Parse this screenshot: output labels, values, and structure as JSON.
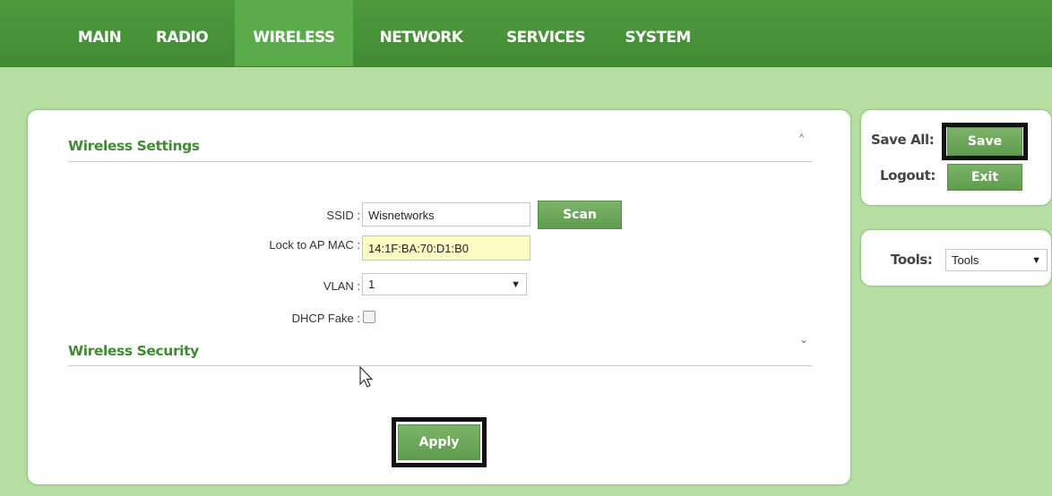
{
  "nav": {
    "tabs": [
      {
        "label": "MAIN"
      },
      {
        "label": "RADIO"
      },
      {
        "label": "WIRELESS",
        "active": true
      },
      {
        "label": "NETWORK"
      },
      {
        "label": "SERVICES"
      },
      {
        "label": "SYSTEM"
      }
    ]
  },
  "wireless_settings": {
    "title": "Wireless Settings",
    "collapse_icon": "chevron-up-icon",
    "ssid": {
      "label": "SSID :",
      "value": "Wisnetworks"
    },
    "scan_label": "Scan",
    "lock_ap_mac": {
      "label": "Lock to AP MAC :",
      "value": "14:1F:BA:70:D1:B0"
    },
    "vlan": {
      "label": "VLAN :",
      "selected": "1"
    },
    "dhcp_fake": {
      "label": "DHCP Fake :",
      "checked": false
    }
  },
  "wireless_security": {
    "title": "Wireless Security",
    "expand_icon": "chevron-down-icon"
  },
  "apply_label": "Apply",
  "sidebar": {
    "save_all_label": "Save All:",
    "save_button": "Save",
    "logout_label": "Logout:",
    "exit_button": "Exit",
    "tools_label": "Tools:",
    "tools_selected": "Tools"
  },
  "colors": {
    "topbar": "#4e9a3e",
    "background": "#b6dea0",
    "accent_text": "#3f8a32",
    "button": "#6ba85a",
    "highlight_input": "#fbfbc4"
  }
}
